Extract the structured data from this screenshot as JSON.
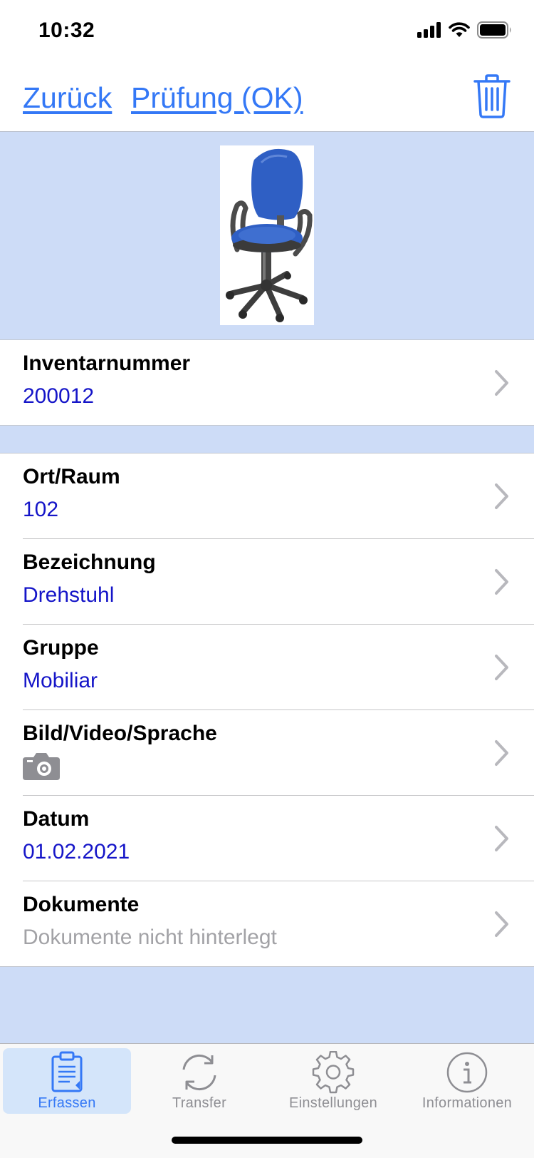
{
  "status_bar": {
    "time": "10:32"
  },
  "nav": {
    "back_label": "Zurück",
    "check_label": "Prüfung (OK)"
  },
  "rows": [
    {
      "label": "Inventarnummer",
      "value": "200012"
    },
    {
      "label": "Ort/Raum",
      "value": "102"
    },
    {
      "label": "Bezeichnung",
      "value": "Drehstuhl"
    },
    {
      "label": "Gruppe",
      "value": "Mobiliar"
    },
    {
      "label": "Bild/Video/Sprache",
      "value": "",
      "icon": "camera-icon"
    },
    {
      "label": "Datum",
      "value": "01.02.2021"
    },
    {
      "label": "Dokumente",
      "value": "Dokumente nicht hinterlegt"
    }
  ],
  "tabs": [
    {
      "label": "Erfassen",
      "icon": "clipboard-icon",
      "active": true
    },
    {
      "label": "Transfer",
      "icon": "sync-icon",
      "active": false
    },
    {
      "label": "Einstellungen",
      "icon": "gear-icon",
      "active": false
    },
    {
      "label": "Informationen",
      "icon": "info-icon",
      "active": false
    }
  ],
  "colors": {
    "accent": "#3478f6",
    "value_text": "#1515c8",
    "muted_text": "#a2a2a6",
    "band_background": "#cddcf7",
    "chair": "#2f5fc4"
  }
}
